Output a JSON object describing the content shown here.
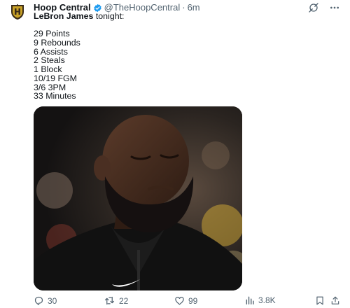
{
  "author": {
    "name": "Hoop Central",
    "handle": "@TheHoopCentral",
    "separator": "·",
    "time": "6m"
  },
  "tweet": {
    "mention": "LeBron James",
    "intro_rest": " tonight:",
    "stats": [
      "29 Points",
      "9 Rebounds",
      "6 Assists",
      "2 Steals",
      "1 Block",
      "10/19 FGM",
      "3/6 3PM",
      "33 Minutes"
    ]
  },
  "media": {
    "alt_icon": "photo-of-player-with-eyes-closed"
  },
  "actions": {
    "replies": "30",
    "retweets": "22",
    "likes": "99",
    "views": "3.8K"
  },
  "colors": {
    "verified": "#1d9bf0",
    "text": "#0f1419",
    "muted": "#536471",
    "avatar_gold": "#c9a227",
    "avatar_dark": "#3a2b18"
  }
}
